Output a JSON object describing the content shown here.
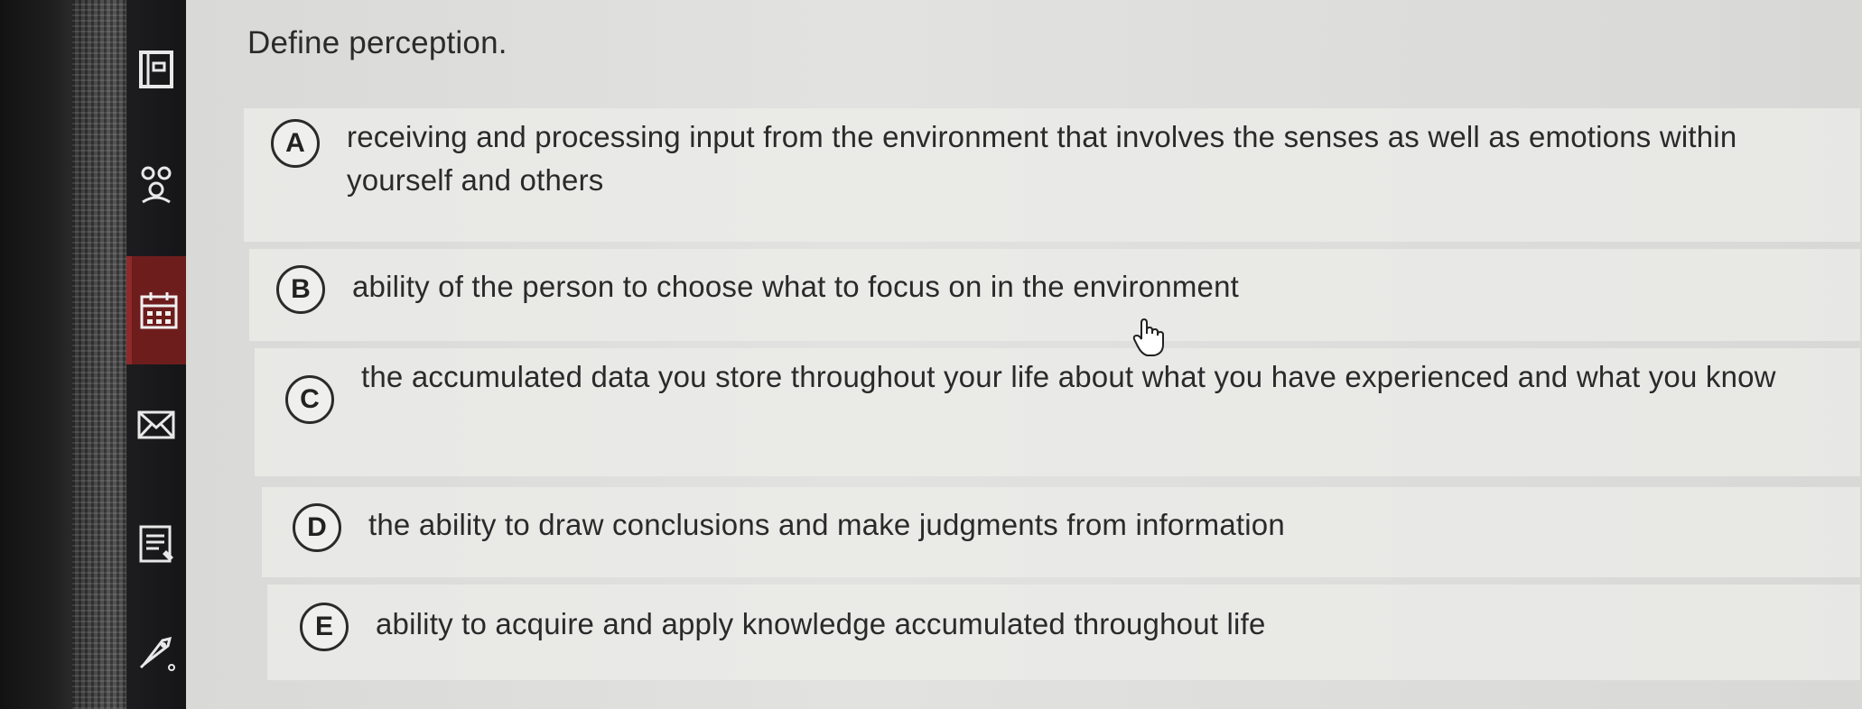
{
  "question": {
    "prompt": "Define perception."
  },
  "options": [
    {
      "letter": "A",
      "text": "receiving and processing input from the environment that involves the senses as well as emotions within yourself and others"
    },
    {
      "letter": "B",
      "text": "ability of the person to choose what to focus on in the environment"
    },
    {
      "letter": "C",
      "text": "the accumulated data you store throughout your life about what you have experienced and what you know"
    },
    {
      "letter": "D",
      "text": "the ability to draw conclusions and make judgments from information"
    },
    {
      "letter": "E",
      "text": "ability to acquire and apply knowledge accumulated throughout life"
    }
  ],
  "sidebar": {
    "items": [
      {
        "icon": "book-icon"
      },
      {
        "icon": "people-icon"
      },
      {
        "icon": "calendar-icon",
        "active": true
      },
      {
        "icon": "mail-icon"
      },
      {
        "icon": "notes-icon"
      },
      {
        "icon": "rocket-icon"
      }
    ]
  },
  "colors": {
    "sidebar_bg": "#1d1d1f",
    "active_item": "#6e1d1d",
    "option_bg": "#ececea",
    "text": "#2a2a2a"
  }
}
